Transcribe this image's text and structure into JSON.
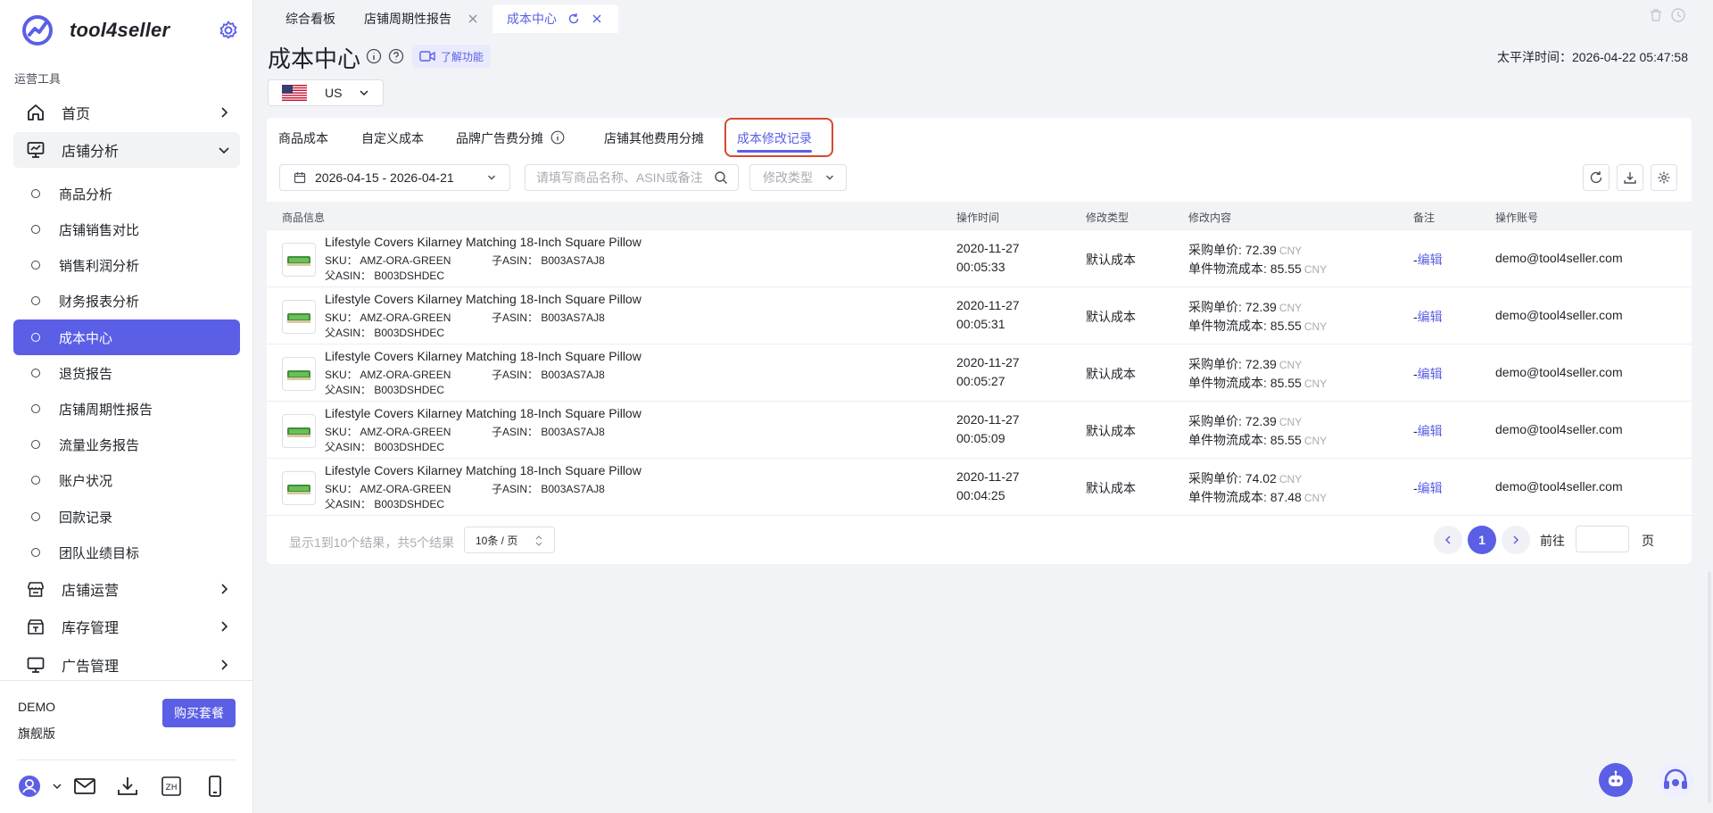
{
  "app": {
    "name": "tool4seller",
    "section": "运营工具"
  },
  "sidebar": {
    "top_items": [
      {
        "label": "首页",
        "icon": "home-icon"
      },
      {
        "label": "店铺分析",
        "icon": "analytics-icon",
        "expanded": true
      },
      {
        "label": "店铺运营",
        "icon": "store-icon"
      },
      {
        "label": "库存管理",
        "icon": "inventory-icon"
      },
      {
        "label": "广告管理",
        "icon": "monitor-icon"
      }
    ],
    "sub_items": [
      "商品分析",
      "店铺销售对比",
      "销售利润分析",
      "财务报表分析",
      "成本中心",
      "退货报告",
      "店铺周期性报告",
      "流量业务报告",
      "账户状况",
      "回款记录",
      "团队业绩目标"
    ],
    "active_sub": "成本中心",
    "account": {
      "name": "DEMO",
      "plan": "旗舰版",
      "buy_label": "购买套餐"
    },
    "footer_icons": [
      "user-avatar-icon",
      "mail-icon",
      "download-icon",
      "zh-language-icon",
      "mobile-icon"
    ]
  },
  "tabs": [
    {
      "label": "综合看板",
      "active": false,
      "closable": false
    },
    {
      "label": "店铺周期性报告",
      "active": false,
      "closable": true
    },
    {
      "label": "成本中心",
      "active": true,
      "closable": true
    }
  ],
  "header": {
    "title": "成本中心",
    "learn_label": "了解功能",
    "timezone_label": "太平洋时间：",
    "timezone_value": "2026-04-22 05:47:58",
    "country": "US"
  },
  "subtabs": [
    "商品成本",
    "自定义成本",
    "品牌广告费分摊",
    "店铺其他费用分摊",
    "成本修改记录"
  ],
  "active_subtab": "成本修改记录",
  "filters": {
    "date_range": "2026-04-15 - 2026-04-21",
    "search_placeholder": "请填写商品名称、ASIN或备注",
    "type_placeholder": "修改类型"
  },
  "table": {
    "columns": [
      "商品信息",
      "操作时间",
      "修改类型",
      "修改内容",
      "备注",
      "操作账号"
    ],
    "rows": [
      {
        "title": "Lifestyle Covers Kilarney Matching 18-Inch Square Pillow",
        "sku_label": "SKU：",
        "sku": "AMZ-ORA-GREEN",
        "child_label": "子ASIN：",
        "child_asin": "B003AS7AJ8",
        "parent_label": "父ASIN：",
        "parent_asin": "B003DSHDEC",
        "date": "2020-11-27",
        "time": "00:05:33",
        "type": "默认成本",
        "purchase_label": "采购单价: ",
        "purchase": "72.39",
        "logistics_label": "单件物流成本: ",
        "logistics": "85.55",
        "currency": "CNY",
        "note": "-",
        "edit": "编辑",
        "account": "demo@tool4seller.com"
      },
      {
        "title": "Lifestyle Covers Kilarney Matching 18-Inch Square Pillow",
        "sku_label": "SKU：",
        "sku": "AMZ-ORA-GREEN",
        "child_label": "子ASIN：",
        "child_asin": "B003AS7AJ8",
        "parent_label": "父ASIN：",
        "parent_asin": "B003DSHDEC",
        "date": "2020-11-27",
        "time": "00:05:31",
        "type": "默认成本",
        "purchase_label": "采购单价: ",
        "purchase": "72.39",
        "logistics_label": "单件物流成本: ",
        "logistics": "85.55",
        "currency": "CNY",
        "note": "-",
        "edit": "编辑",
        "account": "demo@tool4seller.com"
      },
      {
        "title": "Lifestyle Covers Kilarney Matching 18-Inch Square Pillow",
        "sku_label": "SKU：",
        "sku": "AMZ-ORA-GREEN",
        "child_label": "子ASIN：",
        "child_asin": "B003AS7AJ8",
        "parent_label": "父ASIN：",
        "parent_asin": "B003DSHDEC",
        "date": "2020-11-27",
        "time": "00:05:27",
        "type": "默认成本",
        "purchase_label": "采购单价: ",
        "purchase": "72.39",
        "logistics_label": "单件物流成本: ",
        "logistics": "85.55",
        "currency": "CNY",
        "note": "-",
        "edit": "编辑",
        "account": "demo@tool4seller.com"
      },
      {
        "title": "Lifestyle Covers Kilarney Matching 18-Inch Square Pillow",
        "sku_label": "SKU：",
        "sku": "AMZ-ORA-GREEN",
        "child_label": "子ASIN：",
        "child_asin": "B003AS7AJ8",
        "parent_label": "父ASIN：",
        "parent_asin": "B003DSHDEC",
        "date": "2020-11-27",
        "time": "00:05:09",
        "type": "默认成本",
        "purchase_label": "采购单价: ",
        "purchase": "72.39",
        "logistics_label": "单件物流成本: ",
        "logistics": "85.55",
        "currency": "CNY",
        "note": "-",
        "edit": "编辑",
        "account": "demo@tool4seller.com"
      },
      {
        "title": "Lifestyle Covers Kilarney Matching 18-Inch Square Pillow",
        "sku_label": "SKU：",
        "sku": "AMZ-ORA-GREEN",
        "child_label": "子ASIN：",
        "child_asin": "B003AS7AJ8",
        "parent_label": "父ASIN：",
        "parent_asin": "B003DSHDEC",
        "date": "2020-11-27",
        "time": "00:04:25",
        "type": "默认成本",
        "purchase_label": "采购单价: ",
        "purchase": "74.02",
        "logistics_label": "单件物流成本: ",
        "logistics": "87.48",
        "currency": "CNY",
        "note": "-",
        "edit": "编辑",
        "account": "demo@tool4seller.com"
      }
    ]
  },
  "pagination": {
    "result_text": "显示1到10个结果，共5个结果",
    "page_size": "10条 / 页",
    "current_page": "1",
    "goto_label": "前往",
    "goto_suffix": "页"
  },
  "colors": {
    "accent": "#5b5fe6",
    "highlight_border": "#d6482f"
  }
}
